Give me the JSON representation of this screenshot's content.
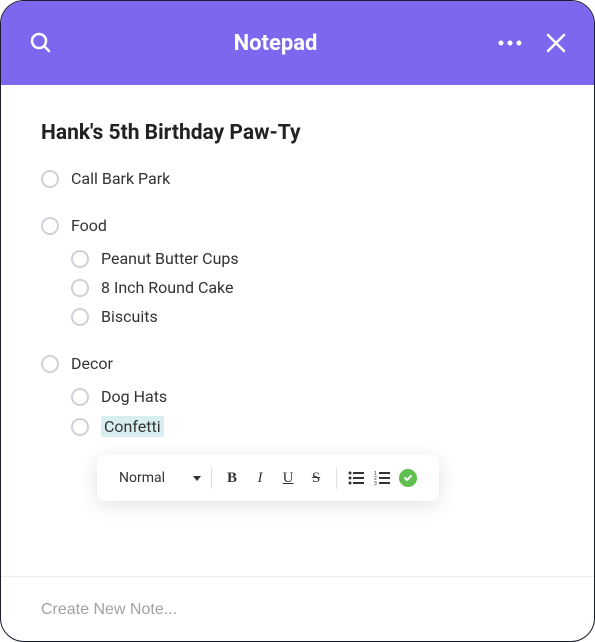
{
  "header": {
    "title": "Notepad"
  },
  "note": {
    "title": "Hank's 5th Birthday Paw-Ty",
    "items": [
      {
        "label": "Call Bark Park",
        "sub": false,
        "group_start": false,
        "selected": false
      },
      {
        "label": "Food",
        "sub": false,
        "group_start": true,
        "selected": false
      },
      {
        "label": "Peanut Butter Cups",
        "sub": true,
        "group_start": false,
        "selected": false
      },
      {
        "label": "8 Inch Round Cake",
        "sub": true,
        "group_start": false,
        "selected": false
      },
      {
        "label": "Biscuits",
        "sub": true,
        "group_start": false,
        "selected": false
      },
      {
        "label": "Decor",
        "sub": false,
        "group_start": true,
        "selected": false
      },
      {
        "label": "Dog Hats",
        "sub": true,
        "group_start": false,
        "selected": false
      },
      {
        "label": "Confetti",
        "sub": true,
        "group_start": false,
        "selected": true
      }
    ]
  },
  "toolbar": {
    "style_label": "Normal"
  },
  "footer": {
    "placeholder": "Create New Note..."
  }
}
